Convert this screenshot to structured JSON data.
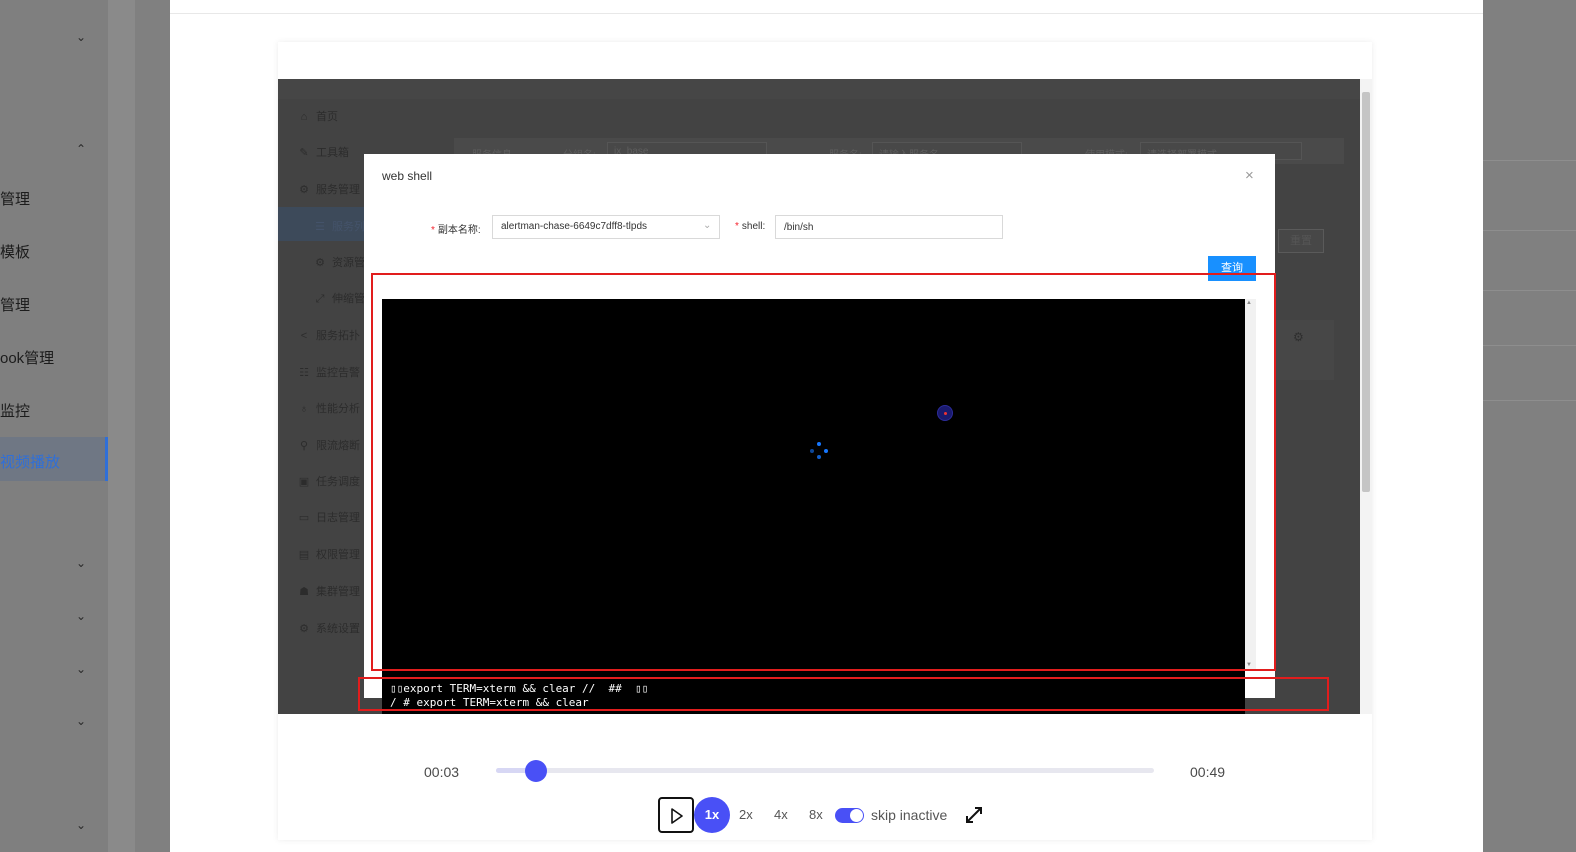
{
  "background_app": {
    "sidebar_labels": [
      "管理",
      "模板",
      "管理",
      "ook管理",
      "监控",
      "视频播放"
    ],
    "active_item": "视频播放"
  },
  "recorded_app": {
    "menu": [
      "首页",
      "工具箱",
      "服务管理",
      "服务列",
      "资源管",
      "伸缩管",
      "服务拓扑",
      "监控告警",
      "性能分析",
      "限流熔断",
      "任务调度",
      "日志管理",
      "权限管理",
      "集群管理",
      "系统设置"
    ],
    "filters": {
      "service_info": "服务信息",
      "group_label": "分组名:",
      "group_value": "jx_base",
      "service_label": "服务名:",
      "service_placeholder": "请输入服务名",
      "deploy_label": "使用模式:",
      "deploy_placeholder": "请选择部署模式"
    },
    "reset_label": "重置"
  },
  "dialog": {
    "title": "web shell",
    "close_symbol": "×",
    "pod_label": "副本名称:",
    "pod_value": "alertman-chase-6649c7dff8-tlpds",
    "shell_label": "shell:",
    "shell_value": "/bin/sh",
    "query_label": "查询"
  },
  "terminal": {
    "line1": "▯▯export TERM=xterm && clear //  ##  ▯▯",
    "line2": "/ # export TERM=xterm && clear"
  },
  "player": {
    "current_time": "00:03",
    "total_time": "00:49",
    "progress_fraction": 0.061,
    "speeds": [
      "1x",
      "2x",
      "4x",
      "8x"
    ],
    "active_speed": "1x",
    "skip_inactive_label": "skip inactive",
    "skip_inactive_on": true
  },
  "colors": {
    "accent": "#4950f6",
    "annotation_red": "#e11d1d",
    "query_blue": "#1890ff"
  },
  "icons": [
    "chevron-down-icon",
    "chevron-up-icon",
    "close-icon",
    "play-icon",
    "fullscreen-icon",
    "loading-spinner-icon"
  ]
}
